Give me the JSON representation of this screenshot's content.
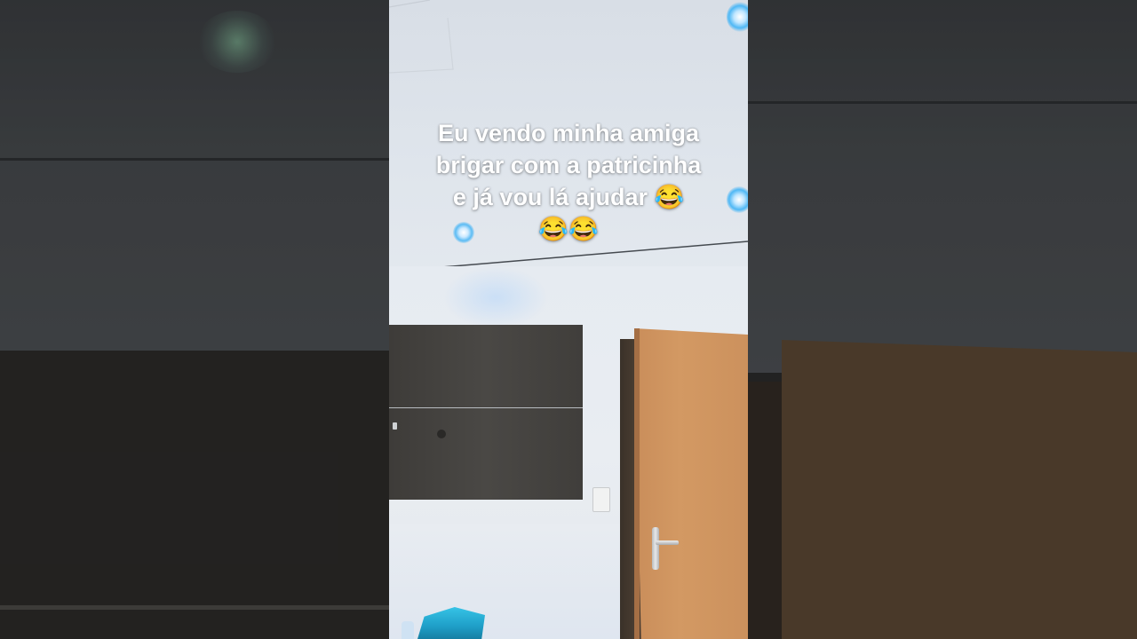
{
  "caption": {
    "line1": "Eu vendo minha amiga",
    "line2": "brigar com a patricinha",
    "line3": "e já vou lá ajudar 😂",
    "line4": "😂😂"
  },
  "colors": {
    "ceiling": "#dfe5ec",
    "wall": "#e8ecf1",
    "tv_panel": "#45433f",
    "door": "#d39963",
    "light_blue": "#4fb8f5"
  }
}
